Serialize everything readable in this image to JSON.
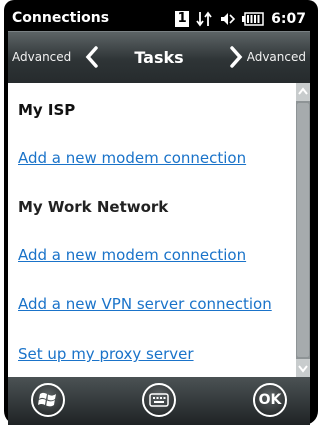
{
  "status_bar": {
    "title": "Connections",
    "notification_count": "1",
    "time": "6:07",
    "icons": [
      "data-sync-icon",
      "speaker-icon",
      "battery-icon"
    ]
  },
  "nav": {
    "prev_label": "Advanced",
    "title": "Tasks",
    "next_label": "Advanced"
  },
  "content": {
    "items": [
      {
        "type": "heading",
        "text": "My ISP"
      },
      {
        "type": "link",
        "text": "Add a new modem connection"
      },
      {
        "type": "heading",
        "text": "My Work Network"
      },
      {
        "type": "link",
        "text": "Add a new modem connection"
      },
      {
        "type": "link",
        "text": "Add a new VPN server connection"
      },
      {
        "type": "link",
        "text": "Set up my proxy server"
      }
    ]
  },
  "bottom_bar": {
    "start_icon": "windows-start-icon",
    "keyboard_icon": "keyboard-icon",
    "ok_label": "OK"
  },
  "colors": {
    "link": "#1a73c9",
    "background": "#ffffff",
    "chrome": "#000000"
  }
}
